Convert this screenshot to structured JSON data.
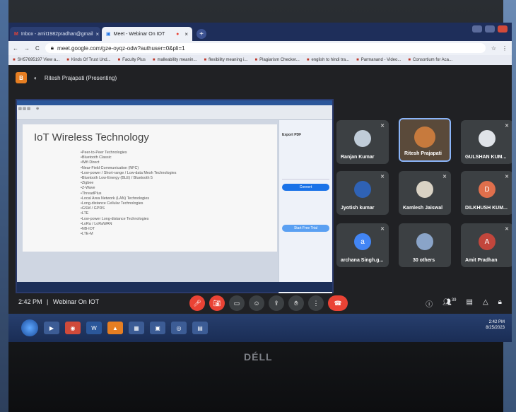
{
  "browser": {
    "tabs": [
      {
        "label": "Inbox - amit1982pradhan@gmail",
        "active": false
      },
      {
        "label": "Meet - Webinar On IOT",
        "active": true
      }
    ],
    "url": "meet.google.com/gze-oyqz-odw?authuser=0&pli=1",
    "bookmarks": [
      "SH57695197 View a...",
      "Kinds Of Trust Und...",
      "Faculty Plus",
      "malleability meanin...",
      "flexibility meaning i...",
      "Plagiarism Checker...",
      "english to hindi tra...",
      "Parmanand - Video...",
      "Consortium for Aca..."
    ]
  },
  "meet": {
    "presenter_label": "Ritesh Prajapati (Presenting)",
    "logo_letter": "B",
    "meeting_time": "2:42 PM",
    "meeting_name": "Webinar On IOT",
    "separator": "|"
  },
  "slide": {
    "title": "IoT Wireless Technology",
    "bullets": [
      "•Peer-to-Peer Technologies",
      "  •Bluetooth Classic",
      "  •Wifi Direct",
      "  •Near-Field Communication (NFC)",
      "•Low-power / Short-range / Low-data Mesh Technologies",
      "  •Bluetooth Low-Energy (BLE) / Bluetooth 5",
      "  •Zigbee",
      "  •Z-Wave",
      "  •ThreadPlus",
      "•Local Area Network (LAN) Technologies",
      "•Long-distance Cellular Technologies",
      "  •GSM / GPRS",
      "  •LTE",
      "•Low-power Long-distance Technologies",
      "  •LoRa / LoRaWAN",
      "  •NB-IOT",
      "  •LTE-M"
    ],
    "side_panel": {
      "title": "Export PDF",
      "button": "Convert",
      "button2": "Start Free Trial"
    }
  },
  "participants": [
    {
      "name": "Ranjan Kumar",
      "avatar": "",
      "color": "#3c4043"
    },
    {
      "name": "Ritesh Prajapati",
      "avatar": "",
      "color": "#5a4a3a"
    },
    {
      "name": "GULSHAN KUM...",
      "avatar": "",
      "color": "#3c4043"
    },
    {
      "name": "Jyotish kumar",
      "avatar": "",
      "color": "#3c4043"
    },
    {
      "name": "Kamlesh Jaiswal",
      "avatar": "",
      "color": "#3c4043"
    },
    {
      "name": "DILKHUSH KUM...",
      "avatar": "D",
      "color": "#3c4043"
    },
    {
      "name": "archana Singh.g...",
      "avatar": "a",
      "color": "#3c4043"
    },
    {
      "name": "30 others",
      "avatar": "",
      "color": "#3c4043"
    },
    {
      "name": "Amit Pradhan",
      "avatar": "A",
      "color": "#3c4043"
    }
  ],
  "people_count": "39",
  "taskbar": {
    "time": "2:42 PM",
    "date": "8/25/2023"
  },
  "brand": "DÉLL",
  "colors": {
    "end_call": "#ea4335",
    "highlight": "#8ab4f8",
    "meet_bg": "#202124"
  }
}
